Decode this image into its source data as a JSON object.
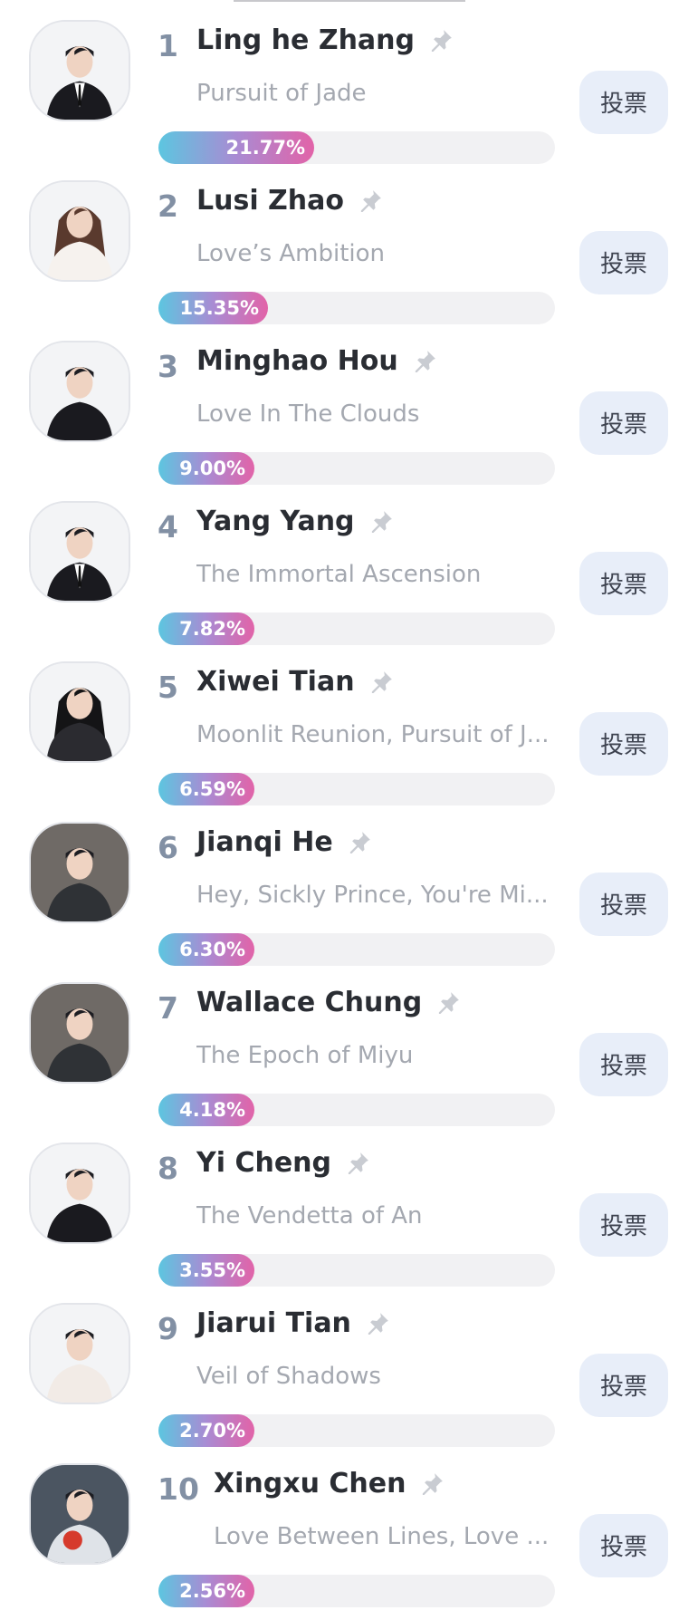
{
  "vote_label": "投票",
  "percent_sign": "%",
  "colors": {
    "gradient_start": "#5cc6e0",
    "gradient_end": "#e263a8",
    "button_bg": "#e8eef9",
    "rank": "#8290a4"
  },
  "rankings": [
    {
      "rank": "1",
      "name": "Ling he Zhang",
      "subtitle": "Pursuit of Jade",
      "percent": "21.77",
      "share": 21.77,
      "avatar": "man-in-suit"
    },
    {
      "rank": "2",
      "name": "Lusi Zhao",
      "subtitle": "Love’s Ambition",
      "percent": "15.35",
      "share": 15.35,
      "avatar": "woman-long-hair"
    },
    {
      "rank": "3",
      "name": "Minghao Hou",
      "subtitle": "Love In The Clouds",
      "percent": "9.00",
      "share": 9.0,
      "avatar": "man-dark-jacket"
    },
    {
      "rank": "4",
      "name": "Yang Yang",
      "subtitle": "The Immortal Ascension",
      "percent": "7.82",
      "share": 7.82,
      "avatar": "man-in-suit"
    },
    {
      "rank": "5",
      "name": "Xiwei Tian",
      "subtitle": "Moonlit Reunion, Pursuit of J...",
      "percent": "6.59",
      "share": 6.59,
      "avatar": "woman-dark-hair"
    },
    {
      "rank": "6",
      "name": "Jianqi He",
      "subtitle": "Hey, Sickly Prince, You're Mi...",
      "percent": "6.30",
      "share": 6.3,
      "avatar": "man-portrait"
    },
    {
      "rank": "7",
      "name": "Wallace Chung",
      "subtitle": "The Epoch of Miyu",
      "percent": "4.18",
      "share": 4.18,
      "avatar": "man-portrait"
    },
    {
      "rank": "8",
      "name": "Yi Cheng",
      "subtitle": "The Vendetta of An",
      "percent": "3.55",
      "share": 3.55,
      "avatar": "man-dark-jacket"
    },
    {
      "rank": "9",
      "name": "Jiarui Tian",
      "subtitle": "Veil of Shadows",
      "percent": "2.70",
      "share": 2.7,
      "avatar": "man-light-outfit"
    },
    {
      "rank": "10",
      "name": "Xingxu Chen",
      "subtitle": "Love Between Lines, Love ...",
      "percent": "2.56",
      "share": 2.56,
      "avatar": "man-holding-apple"
    }
  ]
}
